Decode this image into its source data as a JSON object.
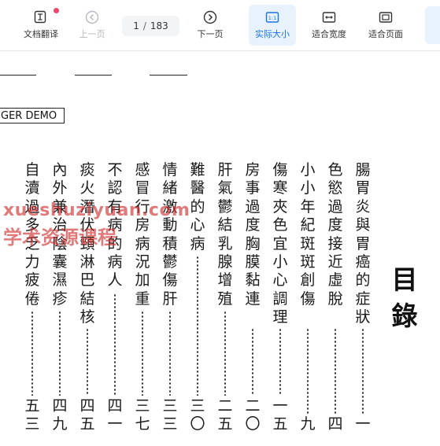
{
  "toolbar": {
    "translate_label": "文档翻译",
    "prev_label": "上一页",
    "page_current": "1",
    "page_separator": "/",
    "page_total": "183",
    "next_label": "下一页",
    "actual_size_label": "实际大小",
    "fit_width_label": "适合宽度",
    "fit_page_label": "适合页面"
  },
  "colors": {
    "accent": "#1a73e8",
    "active_bg": "#e7f2fc",
    "badge": "#f0466b",
    "watermark": "#cd2828"
  },
  "document": {
    "banner_text": "GER DEMO",
    "title": "目錄",
    "entries": [
      {
        "text": "腸胃炎與胃癌的症狀",
        "page": "一"
      },
      {
        "text": "色慾過度 接近虛脫",
        "page": "四"
      },
      {
        "text": "小小年紀 斑斑創傷",
        "page": "九"
      },
      {
        "text": "傷寒夾色宜小心調理",
        "page": "一五"
      },
      {
        "text": "房事過度 胸膜黏連",
        "page": "二〇"
      },
      {
        "text": "肝氣鬱結乳腺增殖",
        "page": "二五"
      },
      {
        "text": "難醫的心病",
        "page": "三〇"
      },
      {
        "text": "情緒激動積鬱傷肝",
        "page": "三三"
      },
      {
        "text": "感冒行房病況加重",
        "page": "三七"
      },
      {
        "text": "不認有病的病人",
        "page": "四一"
      },
      {
        "text": "痰火潛伏頸淋巴結核",
        "page": "四五"
      },
      {
        "text": "內外兼治陰囊濕疹",
        "page": "四九"
      },
      {
        "text": "自瀆過多乏力疲倦",
        "page": "五三"
      }
    ],
    "watermark_line1": "xueshuziyuan.com",
    "watermark_line2": "学术资源课程"
  }
}
